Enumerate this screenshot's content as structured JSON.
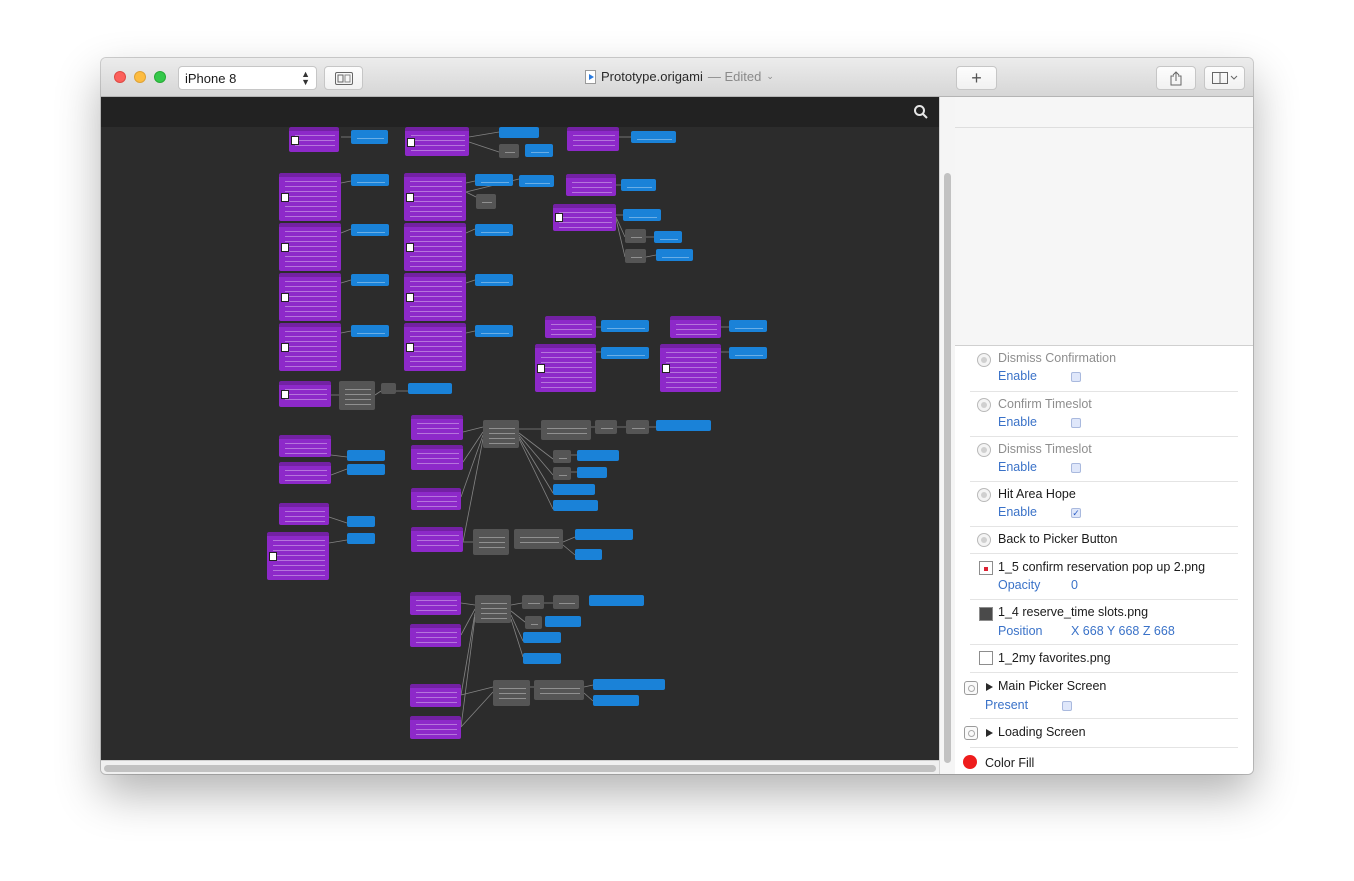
{
  "window": {
    "device": "iPhone 8",
    "document_name": "Prototype.origami",
    "document_status": "— Edited",
    "add_label": "+"
  },
  "inspector": {
    "layers": [
      {
        "name": "Dismiss Confirmation",
        "icon": "circle-layer-icon",
        "dimmed": true,
        "prop": "Enable",
        "control": "checkbox",
        "checked": false
      },
      {
        "name": "Confirm Timeslot",
        "icon": "circle-layer-icon",
        "dimmed": true,
        "prop": "Enable",
        "control": "checkbox",
        "checked": false
      },
      {
        "name": "Dismiss Timeslot",
        "icon": "circle-layer-icon",
        "dimmed": true,
        "prop": "Enable",
        "control": "checkbox",
        "checked": false
      },
      {
        "name": "Hit Area Hope",
        "icon": "circle-layer-icon",
        "dimmed": false,
        "prop": "Enable",
        "control": "checkbox",
        "checked": true,
        "check_mark": "✓"
      },
      {
        "name": "Back to Picker Button",
        "icon": "circle-layer-icon",
        "dimmed": false
      },
      {
        "name": "1_5 confirm reservation pop up 2.png",
        "icon": "image-layer-icon",
        "prop": "Opacity",
        "value": "0"
      },
      {
        "name": "1_4 reserve_time slots.png",
        "icon": "image-layer-icon",
        "prop": "Position",
        "value": "X 668 Y 668 Z 668"
      },
      {
        "name": "1_2my favorites.png",
        "icon": "image-layer-icon"
      },
      {
        "name": "Main Picker Screen",
        "icon": "group-layer-icon",
        "prop": "Present",
        "control": "checkbox",
        "checked": false
      },
      {
        "name": "Loading Screen",
        "icon": "group-layer-icon"
      },
      {
        "name": "Color Fill",
        "icon": "color-fill-icon",
        "color": "#ee1c1c"
      }
    ]
  },
  "colors": {
    "patch_purple": "#8d29c9",
    "patch_blue": "#1a82d8",
    "patch_gray": "#555555",
    "canvas": "#2c2c2c"
  }
}
